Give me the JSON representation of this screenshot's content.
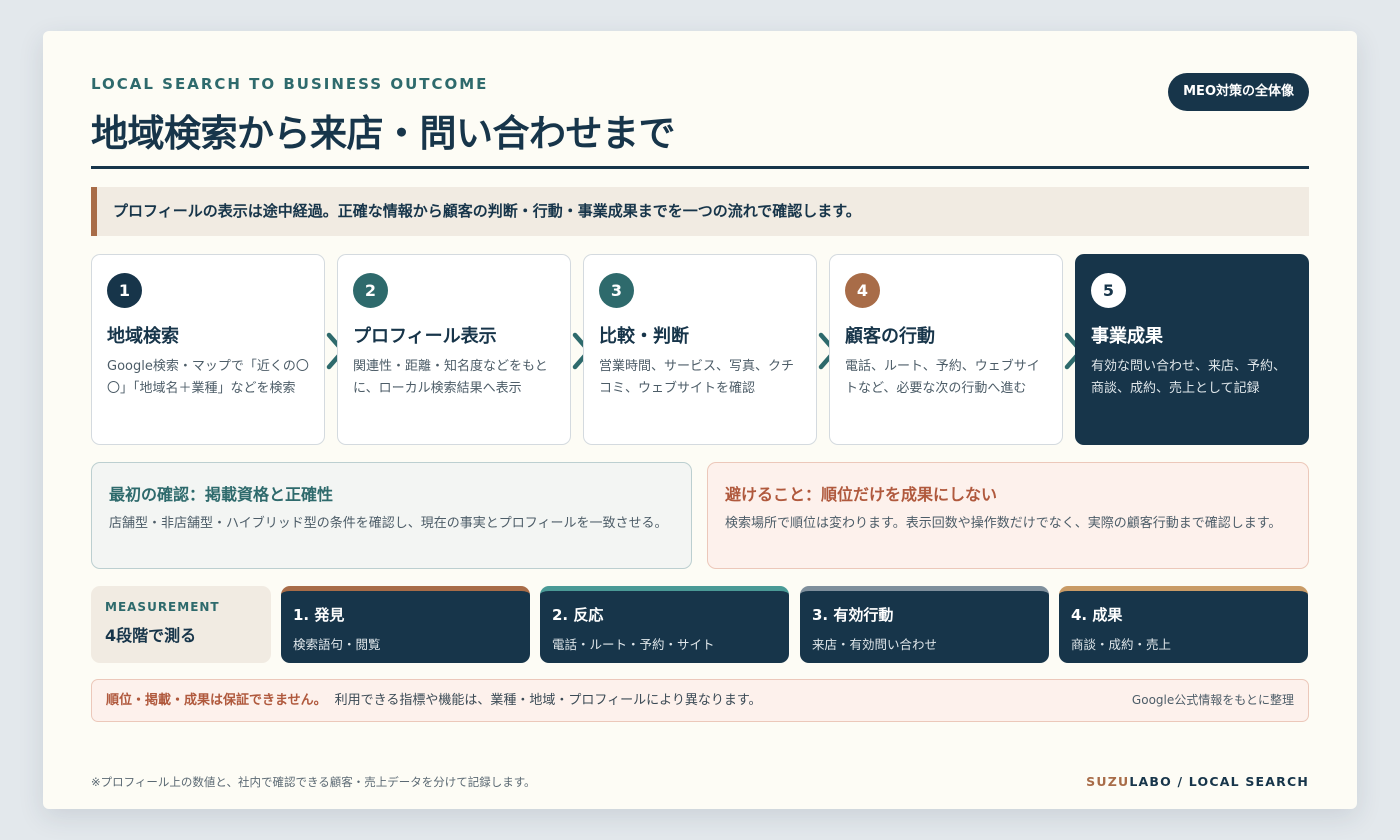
{
  "header": {
    "eyebrow": "LOCAL SEARCH TO BUSINESS OUTCOME",
    "title": "地域検索から来店・問い合わせまで",
    "badge": "MEO対策の全体像"
  },
  "lead": "プロフィールの表示は途中経過。正確な情報から顧客の判断・行動・事業成果までを一つの流れで確認します。",
  "steps": [
    {
      "num": "1",
      "title": "地域検索",
      "desc": "Google検索・マップで「近くの〇〇」「地域名＋業種」などを検索",
      "color": "#17354a"
    },
    {
      "num": "2",
      "title": "プロフィール表示",
      "desc": "関連性・距離・知名度などをもとに、ローカル検索結果へ表示",
      "color": "#2e6a6c"
    },
    {
      "num": "3",
      "title": "比較・判断",
      "desc": "営業時間、サービス、写真、クチコミ、ウェブサイトを確認",
      "color": "#2e6a6c"
    },
    {
      "num": "4",
      "title": "顧客の行動",
      "desc": "電話、ルート、予約、ウェブサイトなど、必要な次の行動へ進む",
      "color": "#a86c48"
    },
    {
      "num": "5",
      "title": "事業成果",
      "desc": "有効な問い合わせ、来店、予約、商談、成約、売上として記録",
      "color": "#ffffff"
    }
  ],
  "notes": {
    "left": {
      "title": "最初の確認：掲載資格と正確性",
      "desc": "店舗型・非店舗型・ハイブリッド型の条件を確認し、現在の事実とプロフィールを一致させる。"
    },
    "right": {
      "title": "避けること：順位だけを成果にしない",
      "desc": "検索場所で順位は変わります。表示回数や操作数だけでなく、実際の顧客行動まで確認します。"
    }
  },
  "measure": {
    "label": "MEASUREMENT",
    "title": "4段階で測る"
  },
  "phases": [
    {
      "title": "1. 発見",
      "desc": "検索語句・閲覧",
      "accent": "#a86c48"
    },
    {
      "title": "2. 反応",
      "desc": "電話・ルート・予約・サイト",
      "accent": "#4a9a96"
    },
    {
      "title": "3. 有効行動",
      "desc": "来店・有効問い合わせ",
      "accent": "#7f8f9c"
    },
    {
      "title": "4. 成果",
      "desc": "商談・成約・売上",
      "accent": "#c99b66"
    }
  ],
  "warning": {
    "bold": "順位・掲載・成果は保証できません。",
    "text": "利用できる指標や機能は、業種・地域・プロフィールにより異なります。",
    "right": "Google公式情報をもとに整理"
  },
  "footer": {
    "note": "※プロフィール上の数値と、社内で確認できる顧客・売上データを分けて記録します。",
    "brand_a": "SUZU",
    "brand_b": "LABO / LOCAL SEARCH"
  },
  "colors": {
    "navy": "#17354a",
    "teal": "#2e6a6c",
    "copper": "#a86c48",
    "alert": "#b0593d"
  }
}
